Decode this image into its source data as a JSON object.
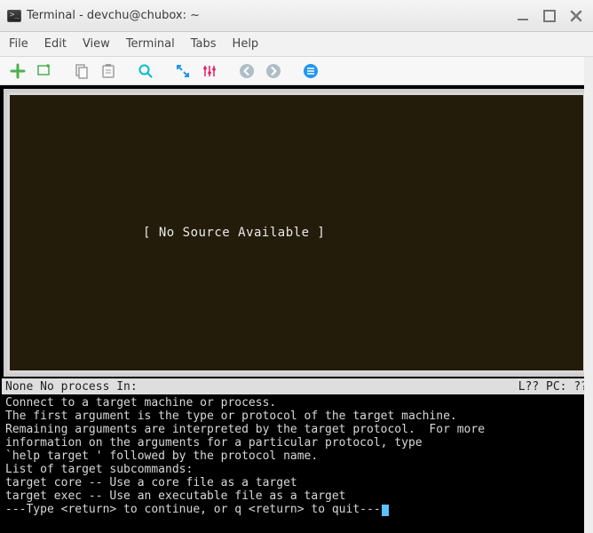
{
  "window": {
    "title": "Terminal - devchu@chubox: ~"
  },
  "menu": [
    "File",
    "Edit",
    "View",
    "Terminal",
    "Tabs",
    "Help"
  ],
  "source_panel": {
    "message": "[ No Source Available ]"
  },
  "status": {
    "left": "None No process In:",
    "right": "L??   PC: ??"
  },
  "console_lines": [
    "Connect to a target machine or process.",
    "The first argument is the type or protocol of the target machine.",
    "Remaining arguments are interpreted by the target protocol.  For more",
    "information on the arguments for a particular protocol, type",
    "`help target ' followed by the protocol name.",
    "",
    "List of target subcommands:",
    "",
    "target core -- Use a core file as a target",
    "target exec -- Use an executable file as a target",
    "---Type <return> to continue, or q <return> to quit---"
  ]
}
